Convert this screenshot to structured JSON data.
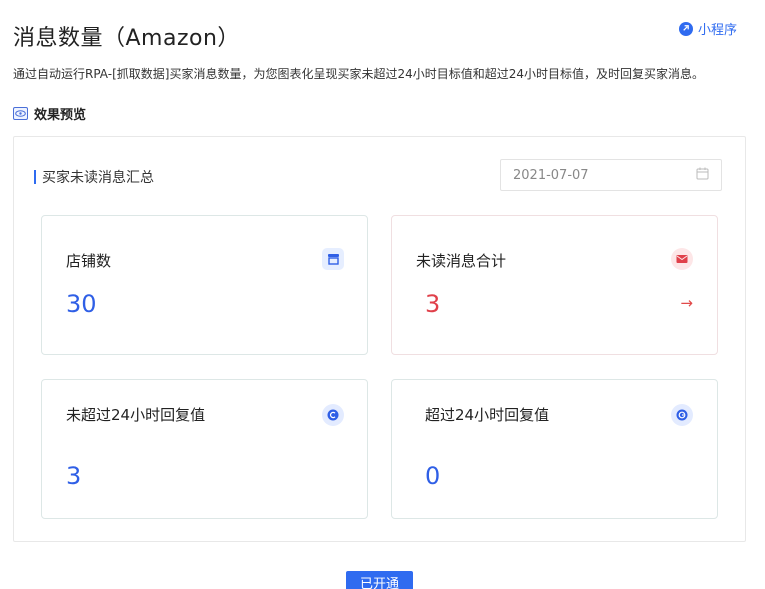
{
  "header": {
    "title": "消息数量（Amazon）",
    "mini_program_label": "小程序",
    "description": "通过自动运行RPA-[抓取数据]买家消息数量，为您图表化呈现买家未超过24小时目标值和超过24小时目标值，及时回复买家消息。",
    "preview_label": "效果预览"
  },
  "panel": {
    "heading": "买家未读消息汇总",
    "date": "2021-07-07",
    "cards": [
      {
        "label": "店铺数",
        "value": "30",
        "icon": "store-icon",
        "value_color": "#2f5fe6"
      },
      {
        "label": "未读消息合计",
        "value": "3",
        "icon": "message-icon",
        "value_color": "#e0404a",
        "arrow": "→"
      },
      {
        "label": "未超过24小时回复值",
        "value": "3",
        "icon": "reply-within-icon",
        "value_color": "#2f5fe6"
      },
      {
        "label": "超过24小时回复值",
        "value": "0",
        "icon": "reply-overdue-icon",
        "value_color": "#2f5fe6"
      }
    ]
  },
  "footer": {
    "button_label": "已开通"
  },
  "colors": {
    "accent": "#2f6bf0",
    "danger": "#e0404a"
  }
}
